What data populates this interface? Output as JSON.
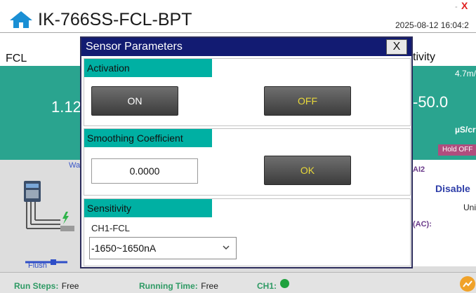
{
  "app": {
    "title": "IK-766SS-FCL-BPT",
    "datetime": "2025-08-12 16:04:2"
  },
  "window_controls": {
    "minimize": "-",
    "close": "X"
  },
  "background": {
    "left_header": "FCL",
    "right_header": "tivity",
    "left_value": "1.12",
    "right_range": "4.7m/",
    "right_value": "-50.0",
    "right_unit": "µS/cr",
    "hold_off": "Hold OFF",
    "wa_label": "Wa",
    "ai2_label": "AI2",
    "disable_label": "Disable",
    "uni_label": "Uni",
    "ac_label": "(AC):",
    "flush_label": "Flush"
  },
  "status_bar": {
    "run_steps_key": "Run Steps:",
    "run_steps_value": "Free",
    "running_time_key": "Running Time:",
    "running_time_value": "Free",
    "ch1_key": "CH1:"
  },
  "dialog": {
    "title": "Sensor Parameters",
    "close_label": "X",
    "activation": {
      "heading": "Activation",
      "on_label": "ON",
      "off_label": "OFF"
    },
    "smoothing": {
      "heading": "Smoothing Coefficient",
      "value": "0.0000",
      "ok_label": "OK"
    },
    "sensitivity": {
      "heading": "Sensitivity",
      "channel_label": "CH1-FCL",
      "selected": "-1650~1650nA"
    }
  },
  "colors": {
    "teal_panel": "#2aa48f",
    "section_header": "#00b0a3",
    "dialog_titlebar": "#121b72",
    "accent_text": "#e8d83a",
    "status_ok": "#1fa13e"
  },
  "icons": [
    "home-icon",
    "chevron-down-icon",
    "trend-chart-icon",
    "status-led-icon"
  ]
}
